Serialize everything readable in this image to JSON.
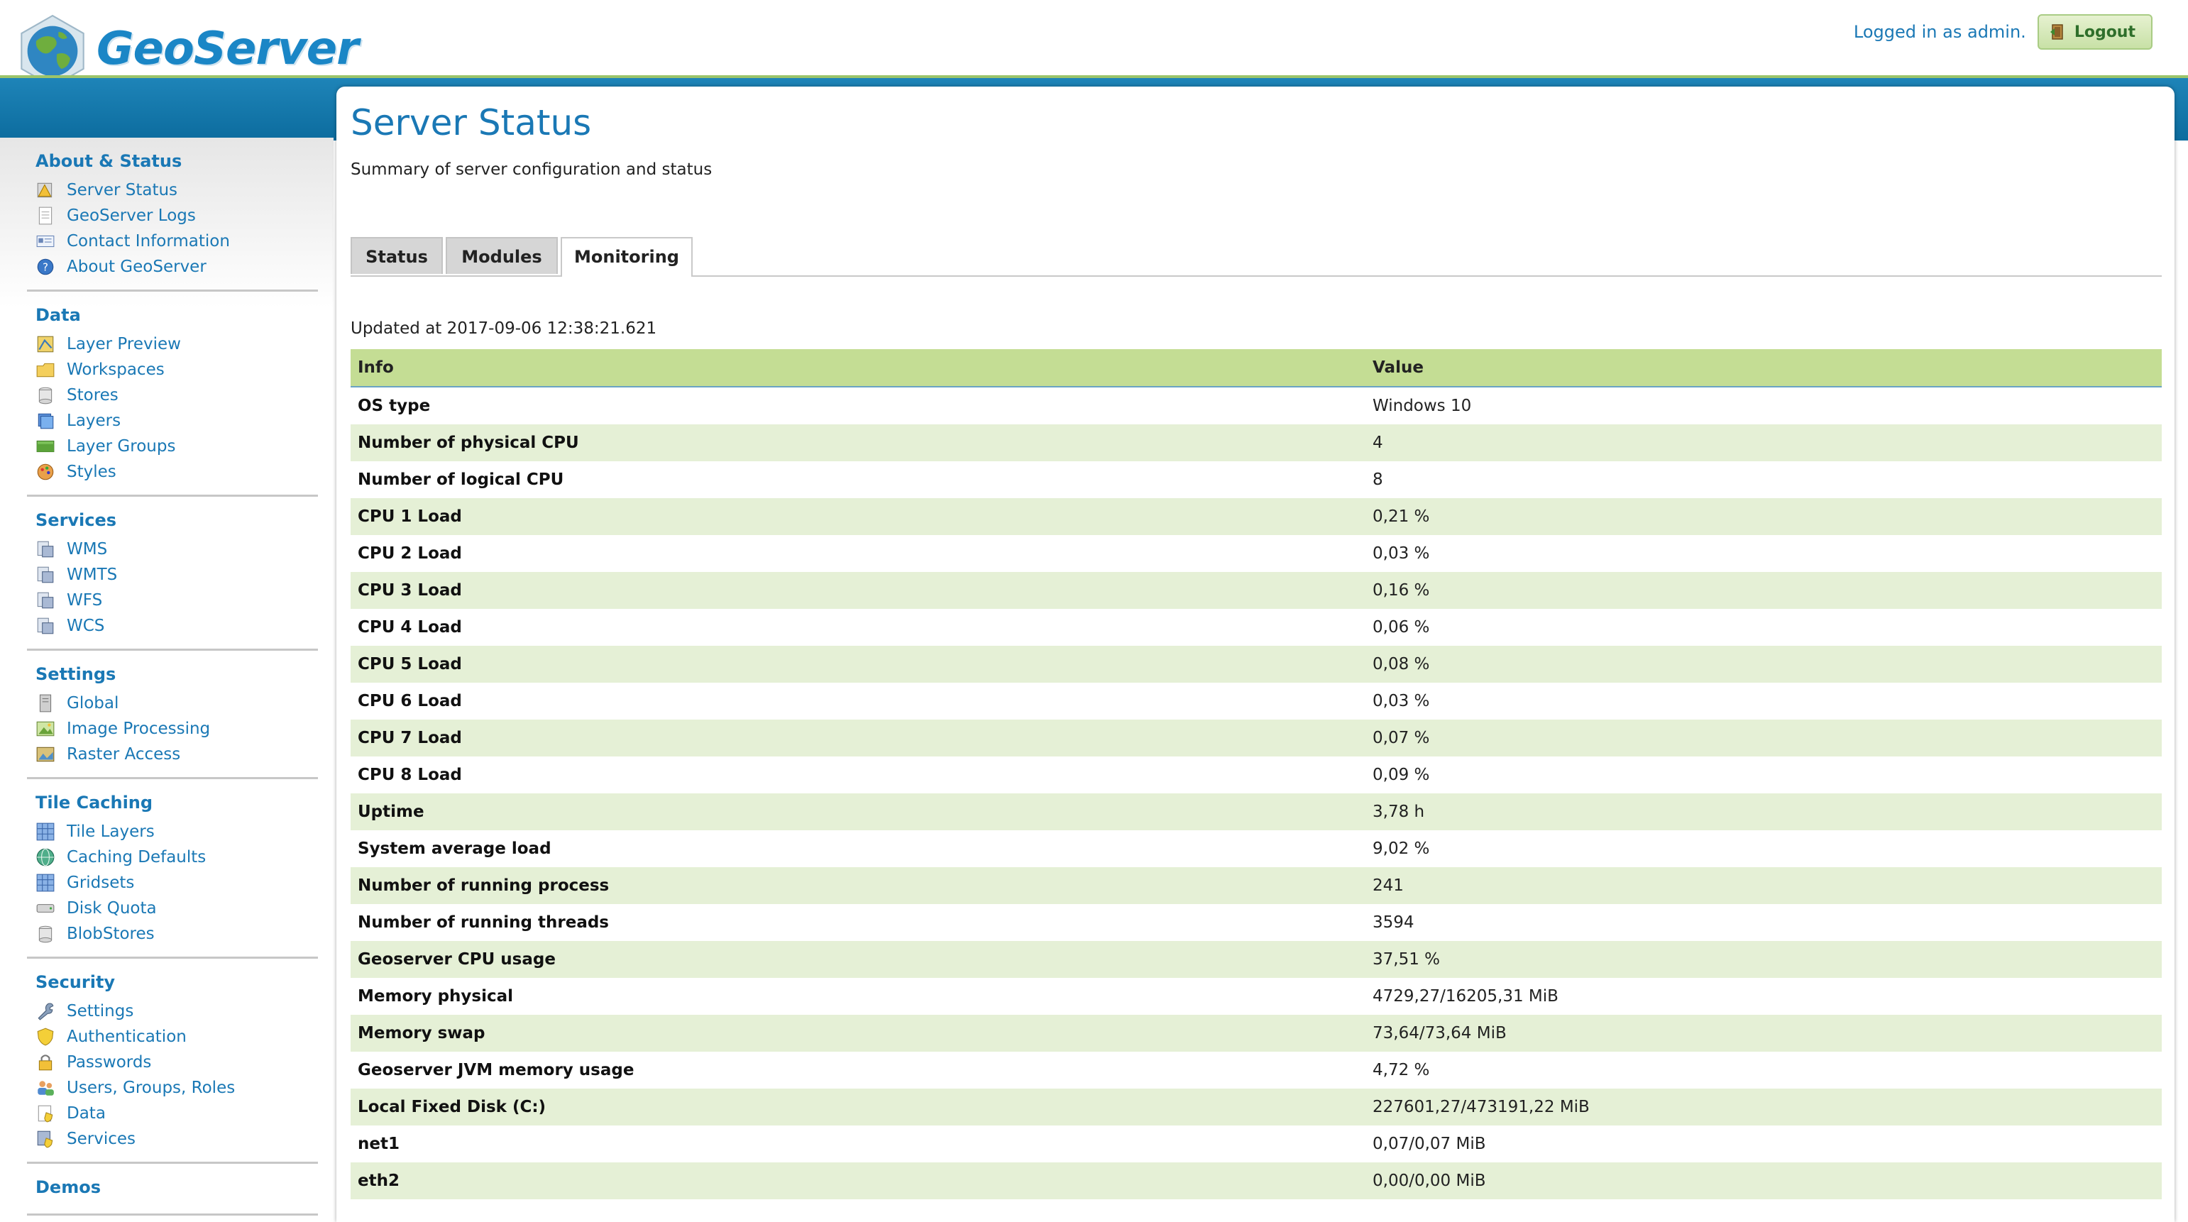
{
  "header": {
    "logo_text": "GeoServer",
    "login_text": "Logged in as admin.",
    "logout_label": "Logout"
  },
  "sidebar": {
    "sections": [
      {
        "title": "About & Status",
        "items": [
          {
            "label": "Server Status",
            "icon": "server-status-icon"
          },
          {
            "label": "GeoServer Logs",
            "icon": "logs-icon"
          },
          {
            "label": "Contact Information",
            "icon": "contact-icon"
          },
          {
            "label": "About GeoServer",
            "icon": "about-icon"
          }
        ]
      },
      {
        "title": "Data",
        "items": [
          {
            "label": "Layer Preview",
            "icon": "layer-preview-icon"
          },
          {
            "label": "Workspaces",
            "icon": "folder-icon"
          },
          {
            "label": "Stores",
            "icon": "store-icon"
          },
          {
            "label": "Layers",
            "icon": "layers-icon"
          },
          {
            "label": "Layer Groups",
            "icon": "layer-groups-icon"
          },
          {
            "label": "Styles",
            "icon": "styles-icon"
          }
        ]
      },
      {
        "title": "Services",
        "items": [
          {
            "label": "WMS",
            "icon": "service-icon"
          },
          {
            "label": "WMTS",
            "icon": "service-icon"
          },
          {
            "label": "WFS",
            "icon": "service-icon"
          },
          {
            "label": "WCS",
            "icon": "service-icon"
          }
        ]
      },
      {
        "title": "Settings",
        "items": [
          {
            "label": "Global",
            "icon": "server-icon"
          },
          {
            "label": "Image Processing",
            "icon": "image-icon"
          },
          {
            "label": "Raster Access",
            "icon": "raster-icon"
          }
        ]
      },
      {
        "title": "Tile Caching",
        "items": [
          {
            "label": "Tile Layers",
            "icon": "grid-icon"
          },
          {
            "label": "Caching Defaults",
            "icon": "globe-icon"
          },
          {
            "label": "Gridsets",
            "icon": "grid-icon"
          },
          {
            "label": "Disk Quota",
            "icon": "disk-icon"
          },
          {
            "label": "BlobStores",
            "icon": "store-icon"
          }
        ]
      },
      {
        "title": "Security",
        "items": [
          {
            "label": "Settings",
            "icon": "wrench-icon"
          },
          {
            "label": "Authentication",
            "icon": "shield-icon"
          },
          {
            "label": "Passwords",
            "icon": "lock-icon"
          },
          {
            "label": "Users, Groups, Roles",
            "icon": "users-icon"
          },
          {
            "label": "Data",
            "icon": "data-security-icon"
          },
          {
            "label": "Services",
            "icon": "services-security-icon"
          }
        ]
      },
      {
        "title": "Demos",
        "items": []
      }
    ]
  },
  "main": {
    "title": "Server Status",
    "description": "Summary of server configuration and status",
    "tabs": [
      {
        "label": "Status",
        "active": false
      },
      {
        "label": "Modules",
        "active": false
      },
      {
        "label": "Monitoring",
        "active": true
      }
    ],
    "updated": "Updated at 2017-09-06 12:38:21.621",
    "table": {
      "headers": [
        "Info",
        "Value"
      ],
      "rows": [
        [
          "OS type",
          "Windows 10"
        ],
        [
          "Number of physical CPU",
          "4"
        ],
        [
          "Number of logical CPU",
          "8"
        ],
        [
          "CPU 1 Load",
          "0,21 %"
        ],
        [
          "CPU 2 Load",
          "0,03 %"
        ],
        [
          "CPU 3 Load",
          "0,16 %"
        ],
        [
          "CPU 4 Load",
          "0,06 %"
        ],
        [
          "CPU 5 Load",
          "0,08 %"
        ],
        [
          "CPU 6 Load",
          "0,03 %"
        ],
        [
          "CPU 7 Load",
          "0,07 %"
        ],
        [
          "CPU 8 Load",
          "0,09 %"
        ],
        [
          "Uptime",
          "3,78 h"
        ],
        [
          "System average load",
          "9,02 %"
        ],
        [
          "Number of running process",
          "241"
        ],
        [
          "Number of running threads",
          "3594"
        ],
        [
          "Geoserver CPU usage",
          "37,51 %"
        ],
        [
          "Memory physical",
          "4729,27/16205,31 MiB"
        ],
        [
          "Memory swap",
          "73,64/73,64 MiB"
        ],
        [
          "Geoserver JVM memory usage",
          "4,72 %"
        ],
        [
          "Local Fixed Disk (C:)",
          "227601,27/473191,22 MiB"
        ],
        [
          "net1",
          "0,07/0,07 MiB"
        ],
        [
          "eth2",
          "0,00/0,00 MiB"
        ]
      ]
    }
  },
  "colors": {
    "link": "#1a78b5",
    "header_band": "#0c6c9e",
    "table_header": "#c4dd94",
    "row_alt": "#e5f0d6"
  }
}
